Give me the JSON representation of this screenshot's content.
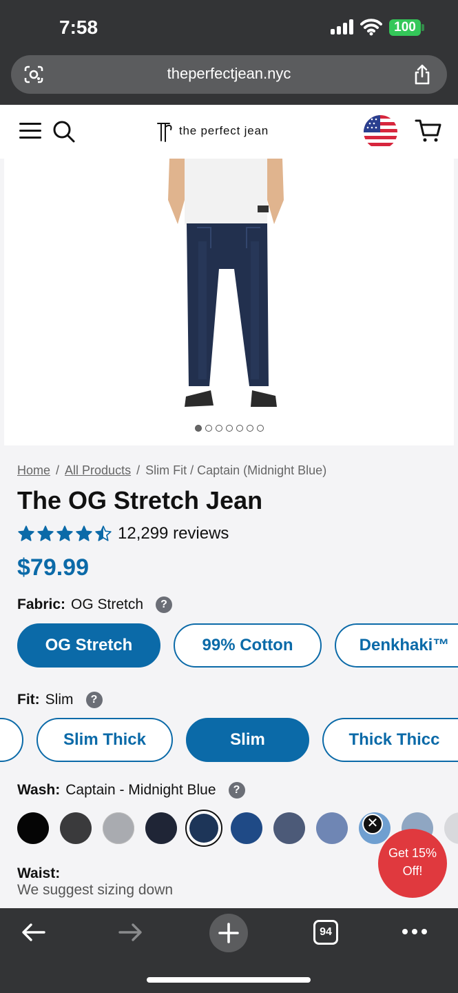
{
  "status_bar": {
    "time": "7:58",
    "battery": "100"
  },
  "browser": {
    "url": "theperfectjean.nyc",
    "tab_count": "94"
  },
  "header": {
    "logo_text": "the perfect jean"
  },
  "gallery": {
    "dot_count": 7,
    "active_index": 0
  },
  "breadcrumb": {
    "home": "Home",
    "all_products": "All Products",
    "current": "Slim Fit / Captain (Midnight Blue)"
  },
  "product": {
    "title": "The OG Stretch Jean",
    "rating": 4.5,
    "reviews": "12,299 reviews",
    "price": "$79.99"
  },
  "fabric": {
    "label": "Fabric:",
    "value": "OG Stretch",
    "options": [
      "OG Stretch",
      "99% Cotton",
      "Denkhaki™"
    ],
    "selected": "OG Stretch"
  },
  "fit": {
    "label": "Fit:",
    "value": "Slim",
    "options": [
      "Slim Thick",
      "Slim",
      "Thick Thicc"
    ],
    "selected": "Slim"
  },
  "wash": {
    "label": "Wash:",
    "value": "Captain - Midnight Blue",
    "swatch_colors": [
      "#050505",
      "#3a3a3c",
      "#a9abb0",
      "#1f2536",
      "#1d3558",
      "#1f4a86",
      "#4c5a78",
      "#6f86b4",
      "#6f9fd0",
      "#8fa6c2",
      "#d8d9dc"
    ],
    "selected_index": 4
  },
  "waist": {
    "label": "Waist:",
    "note": "We suggest sizing down"
  },
  "promo": {
    "line1": "Get 15%",
    "line2": "Off!"
  },
  "help_symbol": "?",
  "close_symbol": "✕",
  "colors": {
    "brand_blue": "#0b6aa8",
    "promo_red": "#e0393e",
    "chrome": "#333436"
  }
}
